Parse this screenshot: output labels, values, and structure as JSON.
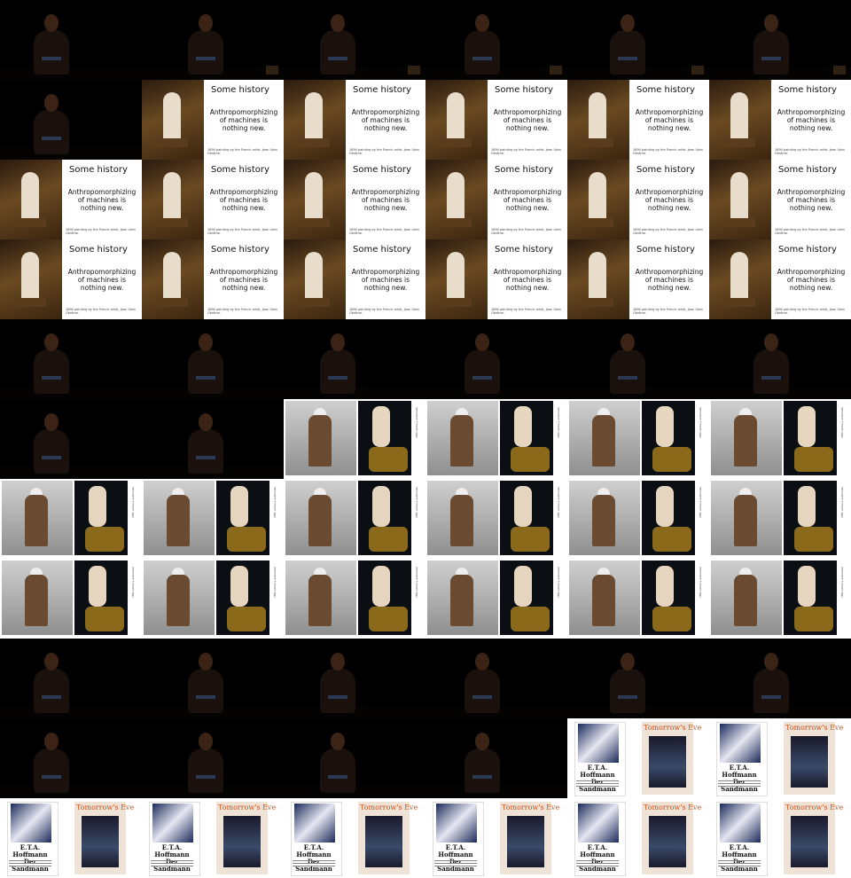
{
  "grid": {
    "columns": 6,
    "rows": 11
  },
  "slide_history": {
    "heading": "Some history",
    "body": "Anthropomorphizing of machines is nothing new.",
    "caption": "1890 painting by the French artist, Jean Léon Gérôme."
  },
  "slide_automata": {
    "caption": "18th century automata",
    "style": "two photographs of automaton figures with rotated caption"
  },
  "slide_books": {
    "cover1_title": "E.T.A. Hoffmann\nDer Sandmann",
    "cover2_title": "Tomorrow's Eve",
    "caption": ""
  },
  "frames": [
    "person",
    "person",
    "person",
    "person",
    "person",
    "person",
    "person",
    "slideA",
    "slideA",
    "slideA",
    "slideA",
    "slideA",
    "slideA",
    "slideA",
    "slideA",
    "slideA",
    "slideA",
    "slideA",
    "slideA",
    "slideA",
    "slideA",
    "slideA",
    "slideA",
    "slideA",
    "person",
    "person",
    "person",
    "person",
    "person",
    "person",
    "person",
    "person",
    "slideB",
    "slideB",
    "slideB",
    "slideB",
    "slideB",
    "slideB",
    "slideB",
    "slideB",
    "slideB",
    "slideB",
    "slideB",
    "slideB",
    "slideB",
    "slideB",
    "slideB",
    "slideB",
    "person",
    "person",
    "person",
    "person",
    "person",
    "person",
    "person",
    "person",
    "person",
    "person",
    "slideC",
    "slideC",
    "slideC",
    "slideC",
    "slideC",
    "slideC",
    "slideC",
    "slideC"
  ]
}
